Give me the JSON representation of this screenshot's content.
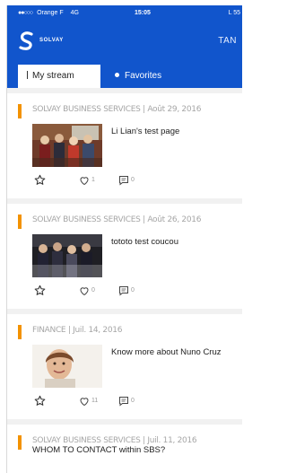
{
  "status_bar": {
    "carrier": "Orange F",
    "network": "4G",
    "time": "15:05",
    "battery_label": "L 55"
  },
  "header": {
    "brand": "SOLVAY",
    "user": "TAN"
  },
  "tabs": [
    {
      "label": "My stream",
      "active": true
    },
    {
      "label": "Favorites",
      "active": false
    }
  ],
  "posts": [
    {
      "meta": "SOLVAY BUSINESS SERVICES | Août 29, 2016",
      "title": "Li Lian's test page",
      "likes": "1",
      "comments": "0",
      "thumbnail": "group-photo"
    },
    {
      "meta": "SOLVAY BUSINESS SERVICES | Août 26, 2016",
      "title": "tototo test coucou",
      "likes": "0",
      "comments": "0",
      "thumbnail": "meeting-photo"
    },
    {
      "meta": "FINANCE | Juil. 14, 2016",
      "title": "Know more about Nuno Cruz",
      "likes": "11",
      "comments": "0",
      "thumbnail": "portrait-photo"
    },
    {
      "meta": "SOLVAY BUSINESS SERVICES | Juil. 11, 2016",
      "title": "WHOM TO CONTACT within SBS?"
    }
  ],
  "colors": {
    "brand_blue": "#1155cc",
    "accent_orange": "#f39200",
    "meta_gray": "#a6a6a6",
    "background": "#f1f1f1"
  }
}
